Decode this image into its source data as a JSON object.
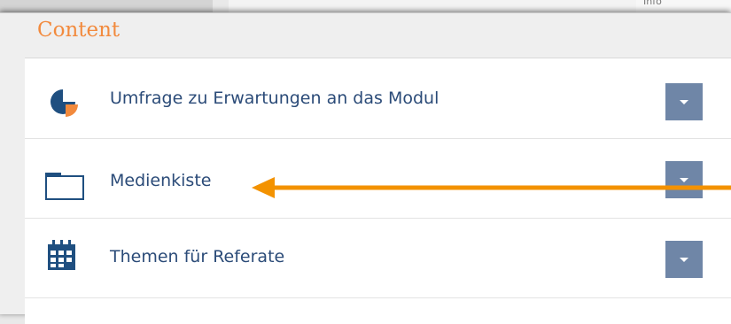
{
  "background": {
    "corner_text": "Info"
  },
  "panel": {
    "title": "Content",
    "items": [
      {
        "label": "Umfrage zu Erwartungen an das Modul",
        "icon": "pie-chart-icon"
      },
      {
        "label": "Medienkiste",
        "icon": "folder-icon"
      },
      {
        "label": "Themen für Referate",
        "icon": "calendar-icon"
      }
    ]
  },
  "colors": {
    "title": "#f28a3d",
    "item_text": "#2b4b78",
    "icon": "#1f4f80",
    "accent": "#f28a3d",
    "button": "#6f86a7",
    "annotation_arrow": "#f39200"
  }
}
